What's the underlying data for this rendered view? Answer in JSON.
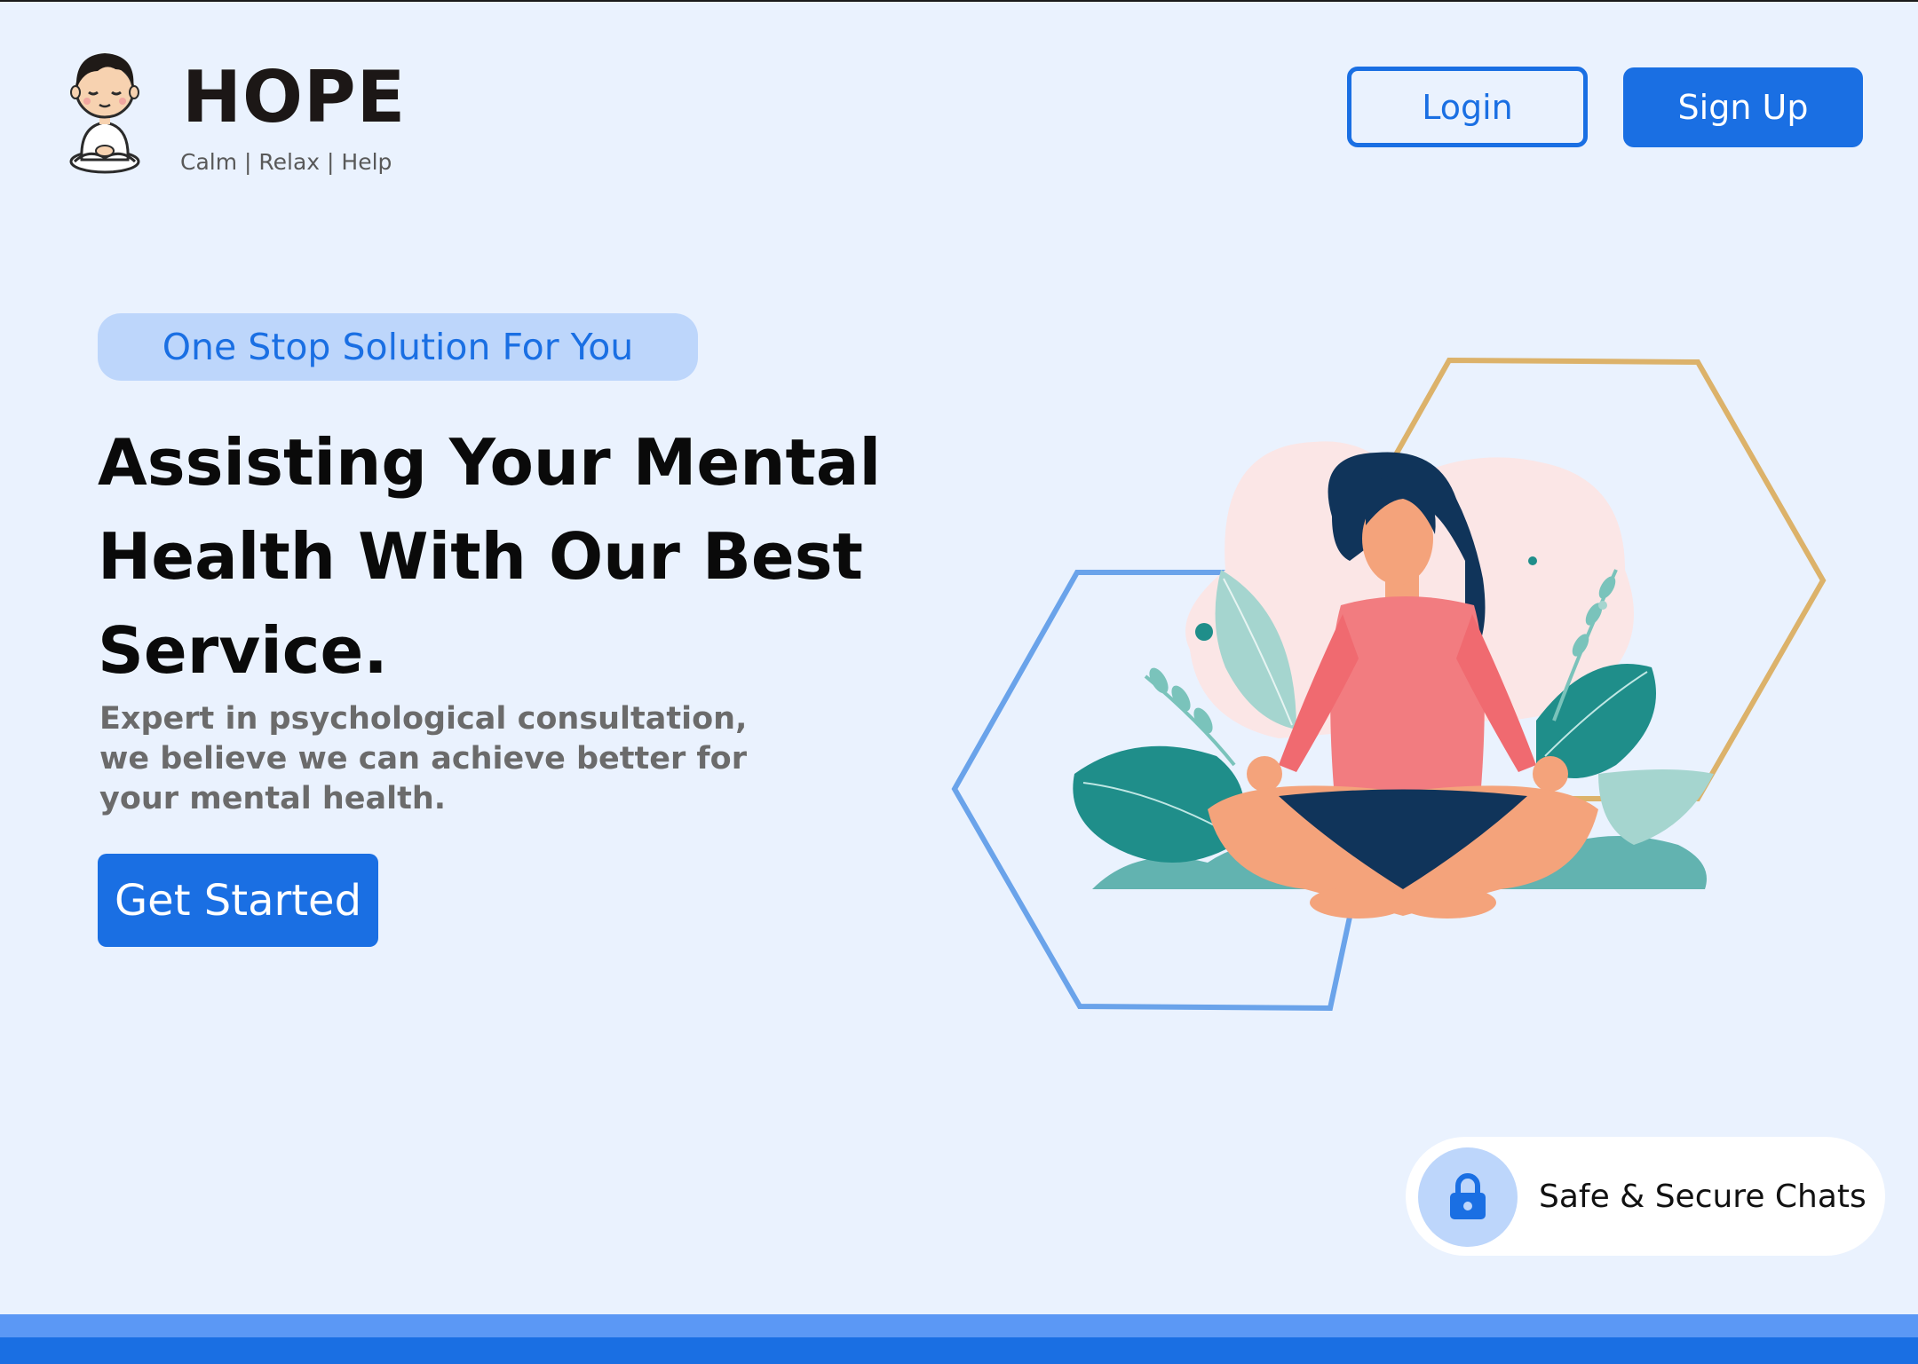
{
  "header": {
    "brand_name": "HOPE",
    "tagline": "Calm | Relax | Help",
    "login_label": "Login",
    "signup_label": "Sign Up"
  },
  "hero": {
    "badge": "One Stop Solution For You",
    "headline_lines": [
      "Assisting Your Mental",
      "Health With Our Best",
      "Service."
    ],
    "description": "Expert in psychological consultation, we believe we can achieve better for your mental health.",
    "cta_label": "Get Started"
  },
  "feature_pill": {
    "icon": "lock-icon",
    "label": "Safe & Secure Chats"
  },
  "colors": {
    "background": "#eaf2fe",
    "primary": "#1a6fe3",
    "badge_bg": "#bdd6fb",
    "hex_gold": "#dcb26a",
    "hex_blue": "#6aa3ea"
  }
}
